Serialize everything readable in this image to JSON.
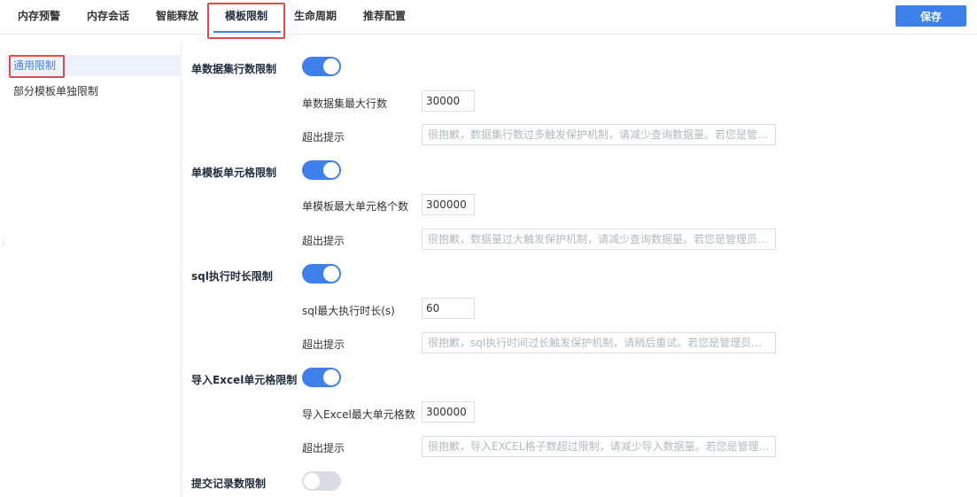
{
  "tabs": [
    {
      "label": "内存预警"
    },
    {
      "label": "内存会话"
    },
    {
      "label": "智能释放"
    },
    {
      "label": "模板限制"
    },
    {
      "label": "生命周期"
    },
    {
      "label": "推荐配置"
    }
  ],
  "active_tab": "模板限制",
  "toolbar": {
    "save_label": "保存"
  },
  "sidebar": {
    "items": [
      {
        "label": "通用限制",
        "selected": true
      },
      {
        "label": "部分模板单独限制",
        "selected": false
      }
    ]
  },
  "colors": {
    "accent": "#3d80e9",
    "highlight_box": "#e34a4a",
    "toggle_off": "#d9dde3"
  },
  "sections": [
    {
      "title": "单数据集行数限制",
      "enabled": true,
      "limit_label": "单数据集最大行数",
      "limit_value": "30000",
      "tip_label": "超出提示",
      "tip_placeholder": "很抱歉，数据集行数过多触发保护机制，请减少查询数据量。若您是管理员，请联系技术支持"
    },
    {
      "title": "单模板单元格限制",
      "enabled": true,
      "limit_label": "单模板最大单元格个数",
      "limit_value": "300000",
      "tip_label": "超出提示",
      "tip_placeholder": "很抱歉，数据量过大触发保护机制，请减少查询数据量。若您是管理员，请联系技术支持"
    },
    {
      "title": "sql执行时长限制",
      "enabled": true,
      "limit_label": "sql最大执行时长(s)",
      "limit_value": "60",
      "tip_label": "超出提示",
      "tip_placeholder": "很抱歉，sql执行时间过长触发保护机制，请稍后重试。若您是管理员，请联系技术支持"
    },
    {
      "title": "导入Excel单元格限制",
      "enabled": true,
      "limit_label": "导入Excel最大单元格数",
      "limit_value": "300000",
      "tip_label": "超出提示",
      "tip_placeholder": "很抱歉，导入EXCEL格子数超过限制，请减少导入数据量。若您是管理员，请联系技术支持"
    },
    {
      "title": "提交记录数限制",
      "enabled": false
    }
  ]
}
